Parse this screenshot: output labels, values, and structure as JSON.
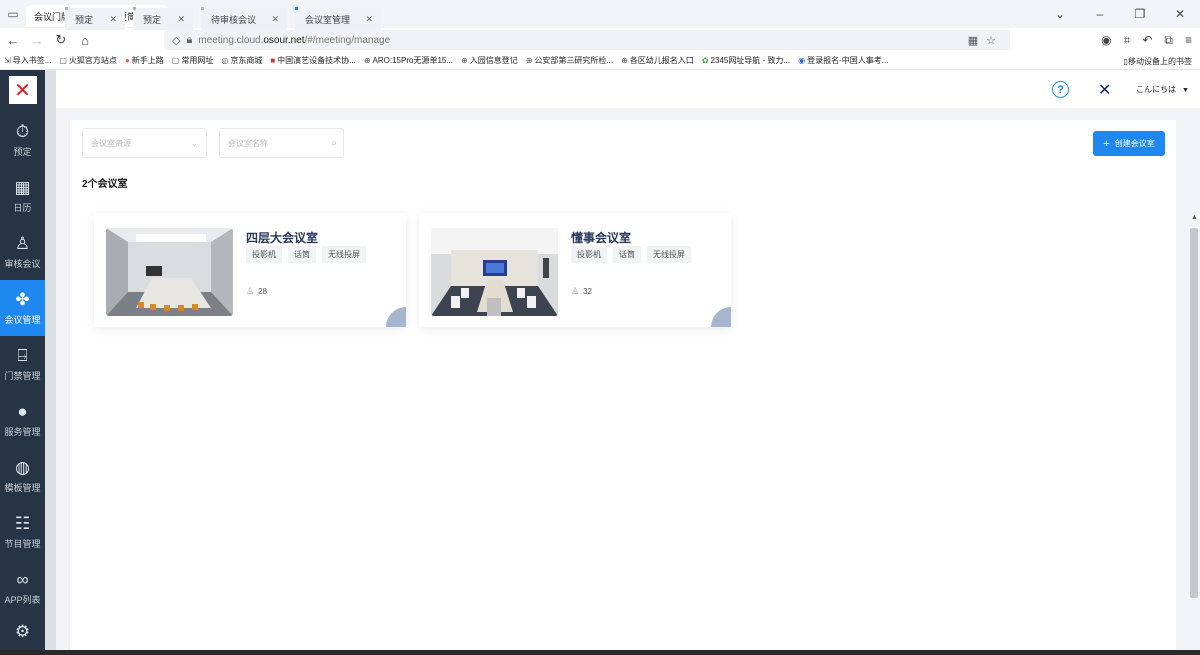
{
  "browser": {
    "tab_title": "会议门牌-让会议变得更简单",
    "url_prefix": "meeting.cloud.",
    "url_domain": "osour.net",
    "url_path": "/#/meeting/manage",
    "bookmarks": [
      "导入书签...",
      "火狐官方站点",
      "新手上路",
      "常用网址",
      "京东商城",
      "中国演艺设备技术协...",
      "ARO:15Pro无源单15...",
      "入园信息登记",
      "公安部第三研究所检...",
      "各区幼儿报名入口",
      "2345网址导航 - 致力...",
      "登录报名-中国人事考..."
    ],
    "mobile_bookmarks": "移动设备上的书签"
  },
  "sidebar": {
    "items": [
      {
        "label": "预定",
        "icon": "timer-icon"
      },
      {
        "label": "日历",
        "icon": "calendar-icon"
      },
      {
        "label": "审核会议",
        "icon": "user-icon"
      },
      {
        "label": "会议管理",
        "icon": "group-icon"
      },
      {
        "label": "门禁管理",
        "icon": "door-icon"
      },
      {
        "label": "服务管理",
        "icon": "bell-icon"
      },
      {
        "label": "模板管理",
        "icon": "template-icon"
      },
      {
        "label": "节目管理",
        "icon": "program-icon"
      },
      {
        "label": "APP列表",
        "icon": "app-grid-icon"
      }
    ],
    "active_index": 3
  },
  "page_tabs": [
    "预定",
    "预定",
    "待审核会议",
    "会议室管理"
  ],
  "header": {
    "user_name": "こんにちは"
  },
  "filters": {
    "resource_placeholder": "会议室资源",
    "name_placeholder": "会议室名称"
  },
  "create_button": "创建会议室",
  "room_count": "2个会议室",
  "rooms": [
    {
      "name": "四层大会议室",
      "tags": [
        "投影机",
        "话筒",
        "无线投屏"
      ],
      "capacity": "28"
    },
    {
      "name": "懂事会议室",
      "tags": [
        "投影机",
        "话筒",
        "无线投屏"
      ],
      "capacity": "32"
    }
  ]
}
